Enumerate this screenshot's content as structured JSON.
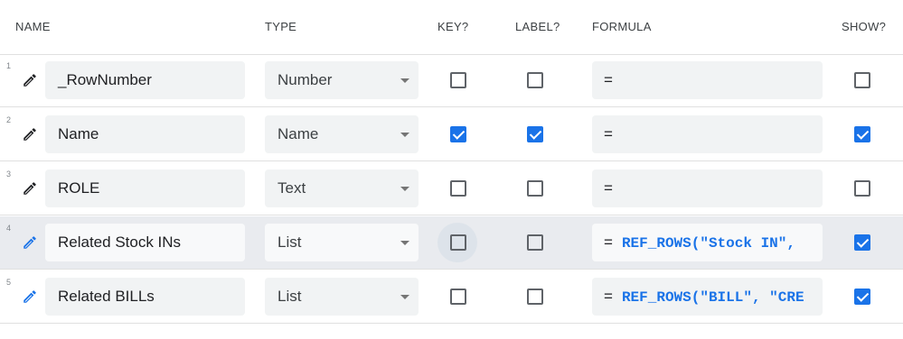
{
  "headers": {
    "name": "NAME",
    "type": "TYPE",
    "key": "KEY?",
    "label": "LABEL?",
    "formula": "FORMULA",
    "show": "SHOW?"
  },
  "rows": [
    {
      "num": "1",
      "name": "_RowNumber",
      "type": "Number",
      "key": false,
      "label": false,
      "formula_prefix": "=",
      "formula": "",
      "show": false
    },
    {
      "num": "2",
      "name": "Name",
      "type": "Name",
      "key": true,
      "label": true,
      "formula_prefix": "=",
      "formula": "",
      "show": true
    },
    {
      "num": "3",
      "name": "ROLE",
      "type": "Text",
      "key": false,
      "label": false,
      "formula_prefix": "=",
      "formula": "",
      "show": false
    },
    {
      "num": "4",
      "name": "Related Stock INs",
      "type": "List",
      "key": false,
      "label": false,
      "formula_prefix": "=",
      "formula": "REF_ROWS(\"Stock IN\",",
      "show": true
    },
    {
      "num": "5",
      "name": "Related BILLs",
      "type": "List",
      "key": false,
      "label": false,
      "formula_prefix": "=",
      "formula": "REF_ROWS(\"BILL\", \"CRE",
      "show": true
    }
  ],
  "colors": {
    "accent": "#1a73e8",
    "pencil_default": "#202124",
    "highlight_row_bg": "#e9ebef"
  },
  "icons": {
    "edit": "pencil-icon",
    "dropdown": "caret-down-icon"
  }
}
